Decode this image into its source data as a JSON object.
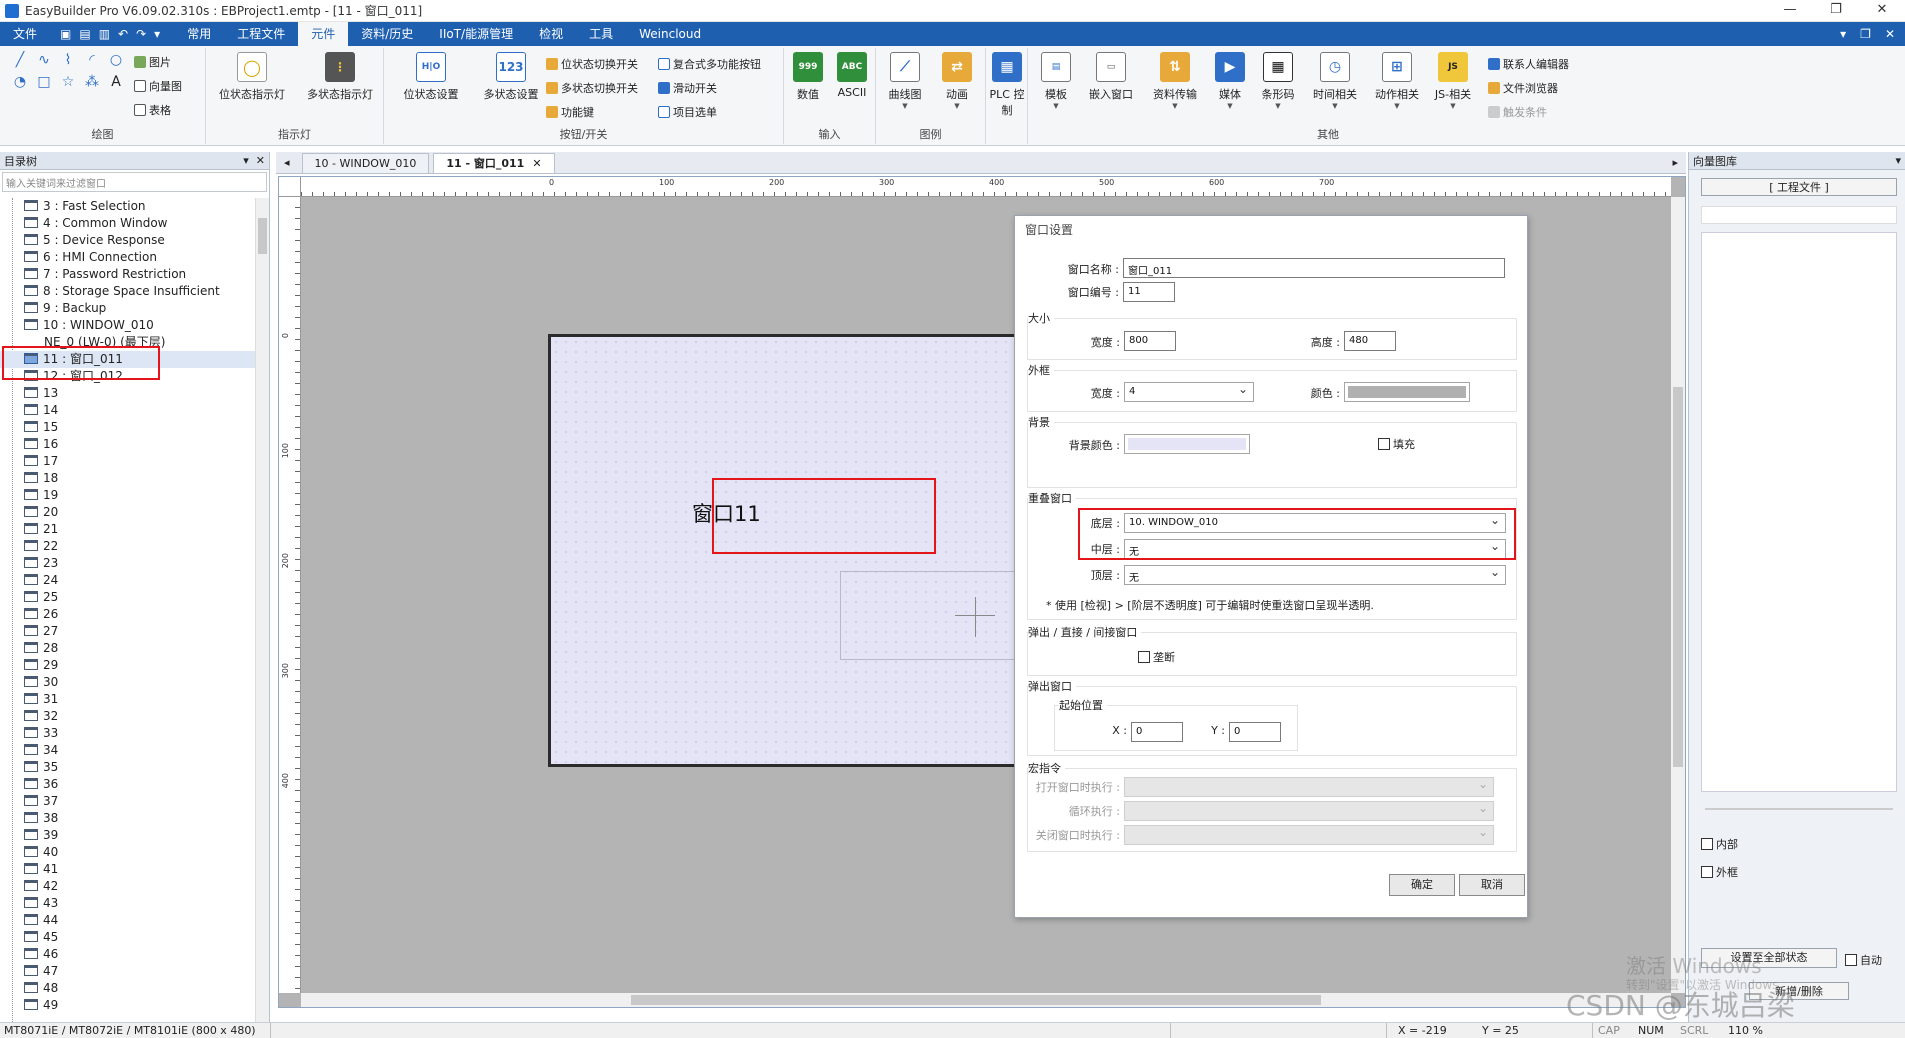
{
  "app": {
    "title": "EasyBuilder Pro V6.09.02.310s : EBProject1.emtp - [11 - 窗口_011]"
  },
  "menu": {
    "items": [
      "文件",
      "常用",
      "工程文件",
      "元件",
      "资料/历史",
      "IIoT/能源管理",
      "检视",
      "工具",
      "Weincloud"
    ],
    "active": "元件"
  },
  "ribbon": {
    "draw": {
      "label": "绘图",
      "picture": "图片",
      "vector": "向量图",
      "table": "表格"
    },
    "indicator": {
      "label": "指示灯",
      "bit_lamp": "位状态指示灯",
      "multi_lamp": "多状态指示灯"
    },
    "switch": {
      "label": "按钮/开关",
      "bit_set": "位状态设置",
      "multi_set": "多状态设置",
      "bit_switch": "位状态切换开关",
      "multi_switch": "多状态切换开关",
      "function_key": "功能键",
      "combo_button": "复合式多功能按钮",
      "slide_switch": "滑动开关",
      "item_select": "项目选单"
    },
    "input": {
      "label": "输入",
      "numeric": "数值",
      "ascii": "ASCII",
      "numeric_icon": "999",
      "ascii_icon": "ABC"
    },
    "chart": {
      "label": "图例",
      "trend": "曲线图",
      "animation": "动画"
    },
    "plc": {
      "label": "PLC 控制",
      "line1": "PLC 控",
      "line2": "制"
    },
    "other": {
      "label": "其他",
      "template": "模板",
      "embed": "嵌入窗口",
      "transfer": "资料传输",
      "media": "媒体",
      "barcode": "条形码",
      "time": "时间相关",
      "action": "动作相关",
      "js": "JS-相关",
      "contacts": "联系人编辑器",
      "file_browser": "文件浏览器",
      "trigger": "触发条件"
    }
  },
  "left_panel": {
    "title": "目录树",
    "filter_placeholder": "输入关键词来过滤窗口",
    "items": [
      {
        "label": "3 : Fast Selection"
      },
      {
        "label": "4 : Common Window"
      },
      {
        "label": "5 : Device Response"
      },
      {
        "label": "6 : HMI Connection"
      },
      {
        "label": "7 : Password Restriction"
      },
      {
        "label": "8 : Storage Space Insufficient"
      },
      {
        "label": "9 : Backup"
      },
      {
        "label": "10 : WINDOW_010"
      },
      {
        "label": "NE_0 (LW-0) (最下层)"
      },
      {
        "label": "11 : 窗口_011"
      },
      {
        "label": "12 : 窗口_012"
      },
      {
        "label": "13"
      },
      {
        "label": "14"
      },
      {
        "label": "15"
      },
      {
        "label": "16"
      },
      {
        "label": "17"
      },
      {
        "label": "18"
      },
      {
        "label": "19"
      },
      {
        "label": "20"
      },
      {
        "label": "21"
      },
      {
        "label": "22"
      },
      {
        "label": "23"
      },
      {
        "label": "24"
      },
      {
        "label": "25"
      },
      {
        "label": "26"
      },
      {
        "label": "27"
      },
      {
        "label": "28"
      },
      {
        "label": "29"
      },
      {
        "label": "30"
      },
      {
        "label": "31"
      },
      {
        "label": "32"
      },
      {
        "label": "33"
      },
      {
        "label": "34"
      },
      {
        "label": "35"
      },
      {
        "label": "36"
      },
      {
        "label": "37"
      },
      {
        "label": "38"
      },
      {
        "label": "39"
      },
      {
        "label": "40"
      },
      {
        "label": "41"
      },
      {
        "label": "42"
      },
      {
        "label": "43"
      },
      {
        "label": "44"
      },
      {
        "label": "45"
      },
      {
        "label": "46"
      },
      {
        "label": "47"
      },
      {
        "label": "48"
      },
      {
        "label": "49"
      }
    ],
    "selected": "11 : 窗口_011"
  },
  "tabs": [
    {
      "label": "10 - WINDOW_010",
      "active": false
    },
    {
      "label": "11 - 窗口_011",
      "active": true
    }
  ],
  "canvas": {
    "window_text": "窗口11",
    "ruler_h": [
      "0",
      "100",
      "200",
      "300",
      "400",
      "500",
      "600",
      "700"
    ],
    "ruler_v": [
      "0",
      "100",
      "200",
      "300",
      "400"
    ]
  },
  "dialog": {
    "title": "窗口设置",
    "name_label": "窗口名称 :",
    "name_value": "窗口_011",
    "number_label": "窗口编号 :",
    "number_value": "11",
    "size_title": "大小",
    "width_label": "宽度 :",
    "width_value": "800",
    "height_label": "高度 :",
    "height_value": "480",
    "frame_title": "外框",
    "frame_width_label": "宽度 :",
    "frame_width_value": "4",
    "frame_color_label": "颜色 :",
    "bg_title": "背景",
    "bg_color_label": "背景颜色 :",
    "fill_label": "填充",
    "overlap_title": "重叠窗口",
    "bottom_label": "底层 :",
    "bottom_value": "10. WINDOW_010",
    "middle_label": "中层 :",
    "middle_value": "无",
    "top_label": "顶层 :",
    "top_value": "无",
    "note": "* 使用 [检视] > [阶层不透明度] 可于编辑时使重迭窗口呈现半透明.",
    "popup_title": "弹出 / 直接 / 间接窗口",
    "monopoly_label": "垄断",
    "popup_win_title": "弹出窗口",
    "start_pos_title": "起始位置",
    "x_label": "X :",
    "x_value": "0",
    "y_label": "Y :",
    "y_value": "0",
    "macro_title": "宏指令",
    "open_macro": "打开窗口时执行 :",
    "cycle_macro": "循环执行 :",
    "close_macro": "关闭窗口时执行 :",
    "ok": "确定",
    "cancel": "取消",
    "colors": {
      "bg_color": "#e4e4f6",
      "frame_color": "#b0b0b0"
    }
  },
  "right_panel": {
    "title": "向量图库",
    "project_files": "[ 工程文件 ]",
    "inner_label": "内部",
    "outer_label": "外框",
    "set_all_state": "设置至全部状态",
    "auto_label": "自动",
    "bottom_btn": "新增/删除"
  },
  "status": {
    "model": "MT8071iE / MT8072iE / MT8101iE (800 x 480)",
    "x": "X = -219",
    "y": "Y = 25",
    "cap": "CAP",
    "num": "NUM",
    "scrl": "SCRL",
    "zoom": "110 %"
  },
  "watermark": {
    "os": "激活 Windows",
    "os_sub": "转到\"设置\"以激活 Windows。",
    "csdn": "CSDN @东城吕梁"
  },
  "highlight_color": "#e3151a"
}
